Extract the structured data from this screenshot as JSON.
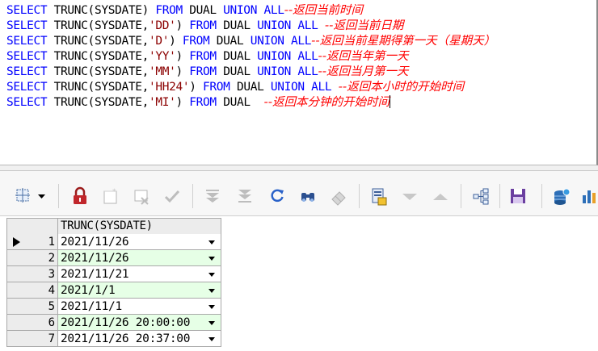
{
  "editor": {
    "lines": [
      {
        "p1": "SELECT",
        "p2": " TRUNC(SYSDATE) ",
        "p3": "FROM",
        "p4": " DUAL ",
        "p5": "UNION ALL",
        "p6": "",
        "p7": "--返回当前时间"
      },
      {
        "p1": "SELECT",
        "p2": " TRUNC(SYSDATE,",
        "p3": "'DD'",
        "p4": ") ",
        "p5": "FROM",
        "p6": " DUAL ",
        "p7": "UNION ALL",
        "p8": " ",
        "p9": "--返回当前日期"
      },
      {
        "p1": "SELECT",
        "p2": " TRUNC(SYSDATE,",
        "p3": "'D'",
        "p4": ") ",
        "p5": "FROM",
        "p6": " DUAL ",
        "p7": "UNION ALL",
        "p8": "",
        "p9": "--返回当前星期得第一天（星期天）"
      },
      {
        "p1": "SELECT",
        "p2": " TRUNC(SYSDATE,",
        "p3": "'YY'",
        "p4": ") ",
        "p5": "FROM",
        "p6": " DUAL ",
        "p7": "UNION ALL",
        "p8": "",
        "p9": "--返回当年第一天"
      },
      {
        "p1": "SELECT",
        "p2": " TRUNC(SYSDATE,",
        "p3": "'MM'",
        "p4": ") ",
        "p5": "FROM",
        "p6": " DUAL ",
        "p7": "UNION ALL",
        "p8": "",
        "p9": "--返回当月第一天"
      },
      {
        "p1": "SELECT",
        "p2": " TRUNC(SYSDATE,",
        "p3": "'HH24'",
        "p4": ") ",
        "p5": "FROM",
        "p6": " DUAL ",
        "p7": "UNION ALL",
        "p8": " ",
        "p9": "--返回本小时的开始时间"
      },
      {
        "p1": "SELECT",
        "p2": " TRUNC(SYSDATE,",
        "p3": "'MI'",
        "p4": ") ",
        "p5": "FROM",
        "p6": " DUAL ",
        "p7": "",
        "p8": " ",
        "p9": "--返回本分钟的开始时间"
      }
    ]
  },
  "toolbar": {
    "buttons": [
      "grid-select-icon",
      "dropdown-arrow-icon",
      "lock-icon",
      "new-record-icon",
      "delete-record-icon",
      "post-checkmark-icon",
      "move-first-icon",
      "move-last-icon",
      "refresh-icon",
      "find-binoculars-icon",
      "clear-eraser-icon",
      "query-by-example-icon",
      "move-down-icon",
      "move-up-icon",
      "tree-view-icon",
      "save-icon",
      "database-export-icon",
      "chart-icon"
    ]
  },
  "grid": {
    "column_header": "TRUNC(SYSDATE)",
    "rows": [
      {
        "num": "1",
        "value": "2021/11/26"
      },
      {
        "num": "2",
        "value": "2021/11/26"
      },
      {
        "num": "3",
        "value": "2021/11/21"
      },
      {
        "num": "4",
        "value": "2021/1/1"
      },
      {
        "num": "5",
        "value": "2021/11/1"
      },
      {
        "num": "6",
        "value": "2021/11/26 20:00:00"
      },
      {
        "num": "7",
        "value": "2021/11/26 20:37:00"
      }
    ],
    "current_row": 1
  }
}
